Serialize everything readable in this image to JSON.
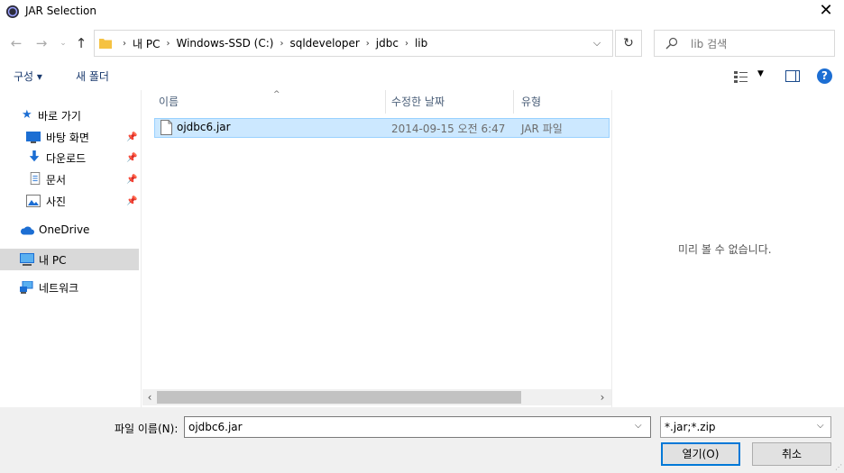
{
  "window": {
    "title": "JAR Selection"
  },
  "nav": {
    "breadcrumbs": [
      "내 PC",
      "Windows-SSD (C:)",
      "sqldeveloper",
      "jdbc",
      "lib"
    ],
    "search_placeholder": "lib 검색"
  },
  "toolbar": {
    "organize": "구성 ▾",
    "new_folder": "새 폴더"
  },
  "sidebar": {
    "quick_access": "바로 가기",
    "desktop": "바탕 화면",
    "downloads": "다운로드",
    "documents": "문서",
    "pictures": "사진",
    "onedrive": "OneDrive",
    "this_pc": "내 PC",
    "network": "네트워크"
  },
  "filelist": {
    "columns": {
      "name": "이름",
      "date": "수정한 날짜",
      "type": "유형"
    },
    "rows": [
      {
        "name": "ojdbc6.jar",
        "date": "2014-09-15 오전 6:47",
        "type": "JAR 파일"
      }
    ]
  },
  "preview": {
    "empty": "미리 볼 수 없습니다."
  },
  "bottom": {
    "filename_label": "파일 이름(N):",
    "filename_value": "ojdbc6.jar",
    "filter_value": "*.jar;*.zip",
    "open_button": "열기(O)",
    "cancel_button": "취소"
  },
  "colors": {
    "accent": "#0078d7",
    "selection": "#cce8ff",
    "folder": "#f5c242"
  }
}
